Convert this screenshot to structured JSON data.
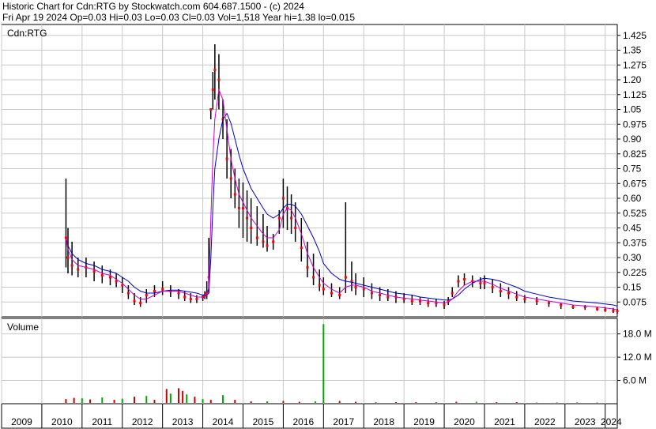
{
  "header": {
    "line1": "Historic Chart for Cdn:RTG by Stockwatch.com 604.687.1500 - (c) 2024",
    "line2": "Fri Apr 19 2024   Op=0.03  Hi=0.03  Lo=0.03  Cl=0.03  Vol=1,518  Year hi=1.38  lo=0.015"
  },
  "colors": {
    "price_bar": "#000000",
    "price_dot": "#ff0000",
    "ma_short": "#cc00cc",
    "ma_long": "#0000cc",
    "volume_normal": "#cc0000",
    "volume_up": "#00aa00",
    "grid": "#c8c8c8"
  },
  "chart_data": {
    "type": "line",
    "title": "Cdn:RTG",
    "price_panel": {
      "label": "Cdn:RTG",
      "ylim": [
        0,
        1.48
      ],
      "yticks": [
        1.425,
        1.35,
        1.275,
        1.2,
        1.125,
        1.05,
        0.975,
        0.9,
        0.825,
        0.75,
        0.675,
        0.6,
        0.525,
        0.45,
        0.375,
        0.3,
        0.225,
        0.15,
        0.075
      ],
      "ytick_labels": [
        "1.425",
        "1.35",
        "1.275",
        "1.20",
        "1.125",
        "1.05",
        "0.975",
        "0.90",
        "0.825",
        "0.75",
        "0.675",
        "0.60",
        "0.525",
        "0.45",
        "0.375",
        "0.30",
        "0.225",
        "0.15",
        "0.075"
      ],
      "grid": true,
      "x": [
        2010.6,
        2010.65,
        2010.75,
        2010.9,
        2011.1,
        2011.3,
        2011.5,
        2011.7,
        2011.85,
        2012.0,
        2012.15,
        2012.3,
        2012.45,
        2012.6,
        2012.8,
        2013.0,
        2013.2,
        2013.4,
        2013.55,
        2013.7,
        2013.85,
        2014.0,
        2014.05,
        2014.1,
        2014.15,
        2014.2,
        2014.25,
        2014.3,
        2014.4,
        2014.5,
        2014.6,
        2014.7,
        2014.8,
        2014.9,
        2015.0,
        2015.1,
        2015.2,
        2015.35,
        2015.5,
        2015.6,
        2015.75,
        2015.9,
        2016.0,
        2016.1,
        2016.2,
        2016.3,
        2016.45,
        2016.6,
        2016.75,
        2016.9,
        2017.0,
        2017.2,
        2017.4,
        2017.55,
        2017.7,
        2017.8,
        2018.0,
        2018.2,
        2018.4,
        2018.6,
        2018.8,
        2019.0,
        2019.2,
        2019.4,
        2019.6,
        2019.8,
        2020.0,
        2020.1,
        2020.2,
        2020.35,
        2020.5,
        2020.7,
        2020.9,
        2021.0,
        2021.2,
        2021.4,
        2021.6,
        2021.8,
        2022.0,
        2022.3,
        2022.6,
        2022.9,
        2023.2,
        2023.5,
        2023.8,
        2024.0,
        2024.2,
        2024.3
      ],
      "series": [
        {
          "kind": "price",
          "high": [
            0.7,
            0.45,
            0.38,
            0.3,
            0.3,
            0.28,
            0.26,
            0.24,
            0.22,
            0.2,
            0.16,
            0.12,
            0.1,
            0.14,
            0.16,
            0.18,
            0.16,
            0.14,
            0.13,
            0.12,
            0.11,
            0.11,
            0.13,
            0.18,
            0.4,
            1.05,
            1.24,
            1.38,
            1.33,
            1.1,
            1.0,
            0.85,
            0.75,
            0.7,
            0.68,
            0.64,
            0.6,
            0.56,
            0.52,
            0.46,
            0.42,
            0.54,
            0.7,
            0.66,
            0.62,
            0.58,
            0.5,
            0.38,
            0.32,
            0.24,
            0.2,
            0.17,
            0.15,
            0.58,
            0.28,
            0.22,
            0.2,
            0.17,
            0.15,
            0.14,
            0.13,
            0.12,
            0.11,
            0.1,
            0.09,
            0.09,
            0.08,
            0.1,
            0.15,
            0.21,
            0.22,
            0.21,
            0.2,
            0.21,
            0.19,
            0.17,
            0.15,
            0.13,
            0.11,
            0.1,
            0.08,
            0.07,
            0.06,
            0.06,
            0.05,
            0.05,
            0.045,
            0.04
          ],
          "low": [
            0.25,
            0.22,
            0.21,
            0.2,
            0.2,
            0.18,
            0.17,
            0.16,
            0.15,
            0.12,
            0.09,
            0.06,
            0.05,
            0.07,
            0.1,
            0.11,
            0.1,
            0.09,
            0.08,
            0.07,
            0.07,
            0.08,
            0.09,
            0.09,
            0.12,
            1.0,
            1.05,
            1.1,
            1.05,
            0.9,
            0.7,
            0.6,
            0.55,
            0.45,
            0.4,
            0.38,
            0.37,
            0.36,
            0.35,
            0.33,
            0.34,
            0.42,
            0.45,
            0.44,
            0.42,
            0.38,
            0.28,
            0.2,
            0.16,
            0.13,
            0.11,
            0.1,
            0.09,
            0.12,
            0.13,
            0.11,
            0.1,
            0.09,
            0.08,
            0.08,
            0.07,
            0.07,
            0.06,
            0.06,
            0.05,
            0.05,
            0.04,
            0.06,
            0.1,
            0.15,
            0.16,
            0.15,
            0.14,
            0.14,
            0.12,
            0.1,
            0.09,
            0.08,
            0.07,
            0.06,
            0.05,
            0.04,
            0.04,
            0.035,
            0.03,
            0.025,
            0.02,
            0.015
          ],
          "close": [
            0.4,
            0.3,
            0.26,
            0.24,
            0.25,
            0.23,
            0.21,
            0.2,
            0.18,
            0.16,
            0.12,
            0.08,
            0.07,
            0.11,
            0.13,
            0.14,
            0.13,
            0.12,
            0.1,
            0.09,
            0.09,
            0.1,
            0.11,
            0.12,
            0.2,
            1.05,
            1.15,
            1.25,
            1.2,
            1.0,
            0.8,
            0.7,
            0.62,
            0.55,
            0.55,
            0.5,
            0.45,
            0.4,
            0.38,
            0.36,
            0.38,
            0.5,
            0.6,
            0.55,
            0.5,
            0.45,
            0.35,
            0.25,
            0.2,
            0.16,
            0.14,
            0.12,
            0.11,
            0.2,
            0.18,
            0.15,
            0.14,
            0.12,
            0.11,
            0.1,
            0.1,
            0.09,
            0.08,
            0.08,
            0.07,
            0.07,
            0.06,
            0.08,
            0.12,
            0.18,
            0.19,
            0.18,
            0.17,
            0.17,
            0.15,
            0.13,
            0.12,
            0.1,
            0.09,
            0.08,
            0.07,
            0.06,
            0.05,
            0.05,
            0.04,
            0.035,
            0.03,
            0.03
          ]
        },
        {
          "kind": "ma_short",
          "values": [
            0.4,
            0.34,
            0.29,
            0.26,
            0.25,
            0.24,
            0.22,
            0.21,
            0.19,
            0.17,
            0.14,
            0.11,
            0.09,
            0.09,
            0.11,
            0.13,
            0.13,
            0.13,
            0.12,
            0.11,
            0.1,
            0.1,
            0.1,
            0.11,
            0.15,
            0.5,
            0.8,
            1.0,
            1.15,
            1.1,
            0.95,
            0.8,
            0.7,
            0.62,
            0.58,
            0.54,
            0.5,
            0.46,
            0.42,
            0.4,
            0.4,
            0.44,
            0.52,
            0.55,
            0.54,
            0.5,
            0.42,
            0.32,
            0.25,
            0.2,
            0.17,
            0.14,
            0.12,
            0.15,
            0.16,
            0.16,
            0.15,
            0.13,
            0.12,
            0.11,
            0.1,
            0.095,
            0.09,
            0.085,
            0.08,
            0.075,
            0.07,
            0.075,
            0.09,
            0.13,
            0.16,
            0.18,
            0.18,
            0.18,
            0.165,
            0.145,
            0.13,
            0.115,
            0.1,
            0.09,
            0.08,
            0.07,
            0.06,
            0.055,
            0.05,
            0.045,
            0.04,
            0.035
          ]
        },
        {
          "kind": "ma_long",
          "values": [
            0.4,
            0.36,
            0.32,
            0.29,
            0.27,
            0.26,
            0.24,
            0.23,
            0.22,
            0.2,
            0.18,
            0.15,
            0.13,
            0.12,
            0.12,
            0.13,
            0.135,
            0.135,
            0.13,
            0.125,
            0.12,
            0.11,
            0.11,
            0.11,
            0.12,
            0.3,
            0.55,
            0.75,
            0.9,
            1.0,
            1.03,
            0.98,
            0.9,
            0.82,
            0.75,
            0.7,
            0.65,
            0.6,
            0.55,
            0.52,
            0.5,
            0.52,
            0.55,
            0.57,
            0.57,
            0.56,
            0.52,
            0.46,
            0.4,
            0.33,
            0.27,
            0.22,
            0.19,
            0.18,
            0.175,
            0.17,
            0.16,
            0.15,
            0.14,
            0.13,
            0.12,
            0.115,
            0.11,
            0.1,
            0.095,
            0.09,
            0.085,
            0.085,
            0.09,
            0.11,
            0.14,
            0.17,
            0.19,
            0.195,
            0.19,
            0.18,
            0.165,
            0.15,
            0.13,
            0.115,
            0.1,
            0.09,
            0.08,
            0.075,
            0.07,
            0.065,
            0.06,
            0.055
          ]
        }
      ]
    },
    "volume_panel": {
      "label": "Volume",
      "ylim": [
        0,
        22
      ],
      "yticks": [
        18.0,
        12.0,
        6.0
      ],
      "ytick_labels": [
        "18.0 M",
        "12.0 M",
        "6.0 M"
      ],
      "unit": "M",
      "bars": [
        {
          "x": 2010.6,
          "v": 1.2,
          "up": false
        },
        {
          "x": 2010.8,
          "v": 1.5,
          "up": false
        },
        {
          "x": 2011.0,
          "v": 1.4,
          "up": true
        },
        {
          "x": 2011.2,
          "v": 1.1,
          "up": false
        },
        {
          "x": 2011.5,
          "v": 1.6,
          "up": true
        },
        {
          "x": 2011.8,
          "v": 1.0,
          "up": false
        },
        {
          "x": 2012.0,
          "v": 1.3,
          "up": true
        },
        {
          "x": 2012.3,
          "v": 1.8,
          "up": false
        },
        {
          "x": 2012.6,
          "v": 2.0,
          "up": true
        },
        {
          "x": 2012.8,
          "v": 1.0,
          "up": false
        },
        {
          "x": 2013.1,
          "v": 3.8,
          "up": false
        },
        {
          "x": 2013.2,
          "v": 2.6,
          "up": true
        },
        {
          "x": 2013.4,
          "v": 4.0,
          "up": false
        },
        {
          "x": 2013.5,
          "v": 3.3,
          "up": false
        },
        {
          "x": 2013.6,
          "v": 2.4,
          "up": true
        },
        {
          "x": 2013.8,
          "v": 1.8,
          "up": false
        },
        {
          "x": 2014.0,
          "v": 1.2,
          "up": true
        },
        {
          "x": 2014.2,
          "v": 1.0,
          "up": false
        },
        {
          "x": 2014.5,
          "v": 2.2,
          "up": true
        },
        {
          "x": 2014.8,
          "v": 1.0,
          "up": false
        },
        {
          "x": 2015.2,
          "v": 0.6,
          "up": false
        },
        {
          "x": 2015.6,
          "v": 0.6,
          "up": true
        },
        {
          "x": 2016.0,
          "v": 0.7,
          "up": false
        },
        {
          "x": 2016.4,
          "v": 0.5,
          "up": false
        },
        {
          "x": 2016.8,
          "v": 0.6,
          "up": true
        },
        {
          "x": 2017.0,
          "v": 0.5,
          "up": false
        },
        {
          "x": 2017.0,
          "v": 20.5,
          "up": true
        },
        {
          "x": 2017.4,
          "v": 0.7,
          "up": false
        },
        {
          "x": 2017.8,
          "v": 0.5,
          "up": false
        },
        {
          "x": 2018.3,
          "v": 0.4,
          "up": true
        },
        {
          "x": 2018.8,
          "v": 0.4,
          "up": false
        },
        {
          "x": 2019.3,
          "v": 0.4,
          "up": false
        },
        {
          "x": 2019.8,
          "v": 0.4,
          "up": true
        },
        {
          "x": 2020.3,
          "v": 0.5,
          "up": false
        },
        {
          "x": 2020.8,
          "v": 0.5,
          "up": true
        },
        {
          "x": 2021.3,
          "v": 0.4,
          "up": false
        },
        {
          "x": 2021.8,
          "v": 0.4,
          "up": false
        },
        {
          "x": 2022.3,
          "v": 0.3,
          "up": true
        },
        {
          "x": 2022.8,
          "v": 0.3,
          "up": false
        },
        {
          "x": 2023.3,
          "v": 0.3,
          "up": false
        },
        {
          "x": 2023.8,
          "v": 0.3,
          "up": false
        }
      ]
    },
    "x_axis": {
      "xlim": [
        2009,
        2024.3
      ],
      "tick_labels": [
        "2009",
        "2010",
        "2011",
        "2012",
        "2013",
        "2014",
        "2015",
        "2016",
        "2017",
        "2018",
        "2019",
        "2020",
        "2021",
        "2022",
        "2023",
        "2024"
      ]
    }
  }
}
